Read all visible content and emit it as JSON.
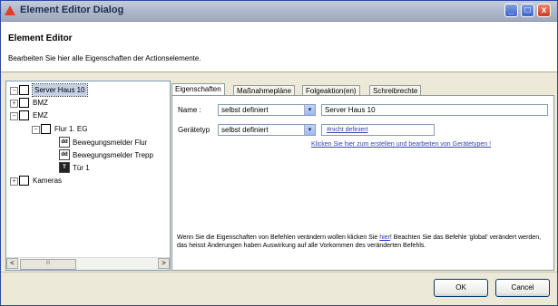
{
  "window": {
    "title": "Element Editor Dialog"
  },
  "header": {
    "title": "Element Editor",
    "subtitle": "Bearbeiten Sie hier alle Eigenschaften der Actionselemente."
  },
  "tree": {
    "root": "Server Haus 10",
    "items": {
      "bmz": "BMZ",
      "emz": "EMZ",
      "flur": "Flur 1. EG",
      "bewegungsmelder_flur": "Bewegungsmelder Flur",
      "bewegungsmelder_trepp": "Bewegungsmelder Trepp",
      "tuer": "Tür 1",
      "kameras": "Kameras"
    },
    "scroll_left": "<",
    "scroll_right": ">",
    "scroll_grip": "III"
  },
  "tabs": [
    "Eigenschaften",
    "Maßnahmepläne",
    "Folgeaktion(en)",
    "Schreibrechte"
  ],
  "form": {
    "name_label": "Name :",
    "name_mode": "selbst definiert",
    "name_value": "Server Haus 10",
    "devicetype_label": "Gerätetyp",
    "devicetype_mode": "selbst definiert",
    "devicetype_value": "#nicht definiert",
    "devicetype_link": "Klicken Sie hier zum erstellen und bearbeiten von Gerätetypen !",
    "info_before": "Wenn Sie die Eigenschaften von Befehlen verändern wollen klicken Sie ",
    "info_link": "hier",
    "info_after": "! Beachten Sie das Befehle 'global' verändert werden, das heisst Änderungen haben Auswirkung auf alle Vorkommen des veränderten Befehls."
  },
  "buttons": {
    "ok": "OK",
    "cancel": "Cancel"
  },
  "window_buttons": {
    "minimize": "_",
    "maximize": "□",
    "close": "x"
  },
  "icons": {
    "detector": "dd",
    "door": "T"
  },
  "tree_markers": {
    "expanded": "−",
    "collapsed": "+",
    "dropdown": "▾"
  },
  "colors": {
    "titlebar": "#aeb8ca",
    "link": "#3344bb",
    "selection": "#c6d1e6"
  }
}
